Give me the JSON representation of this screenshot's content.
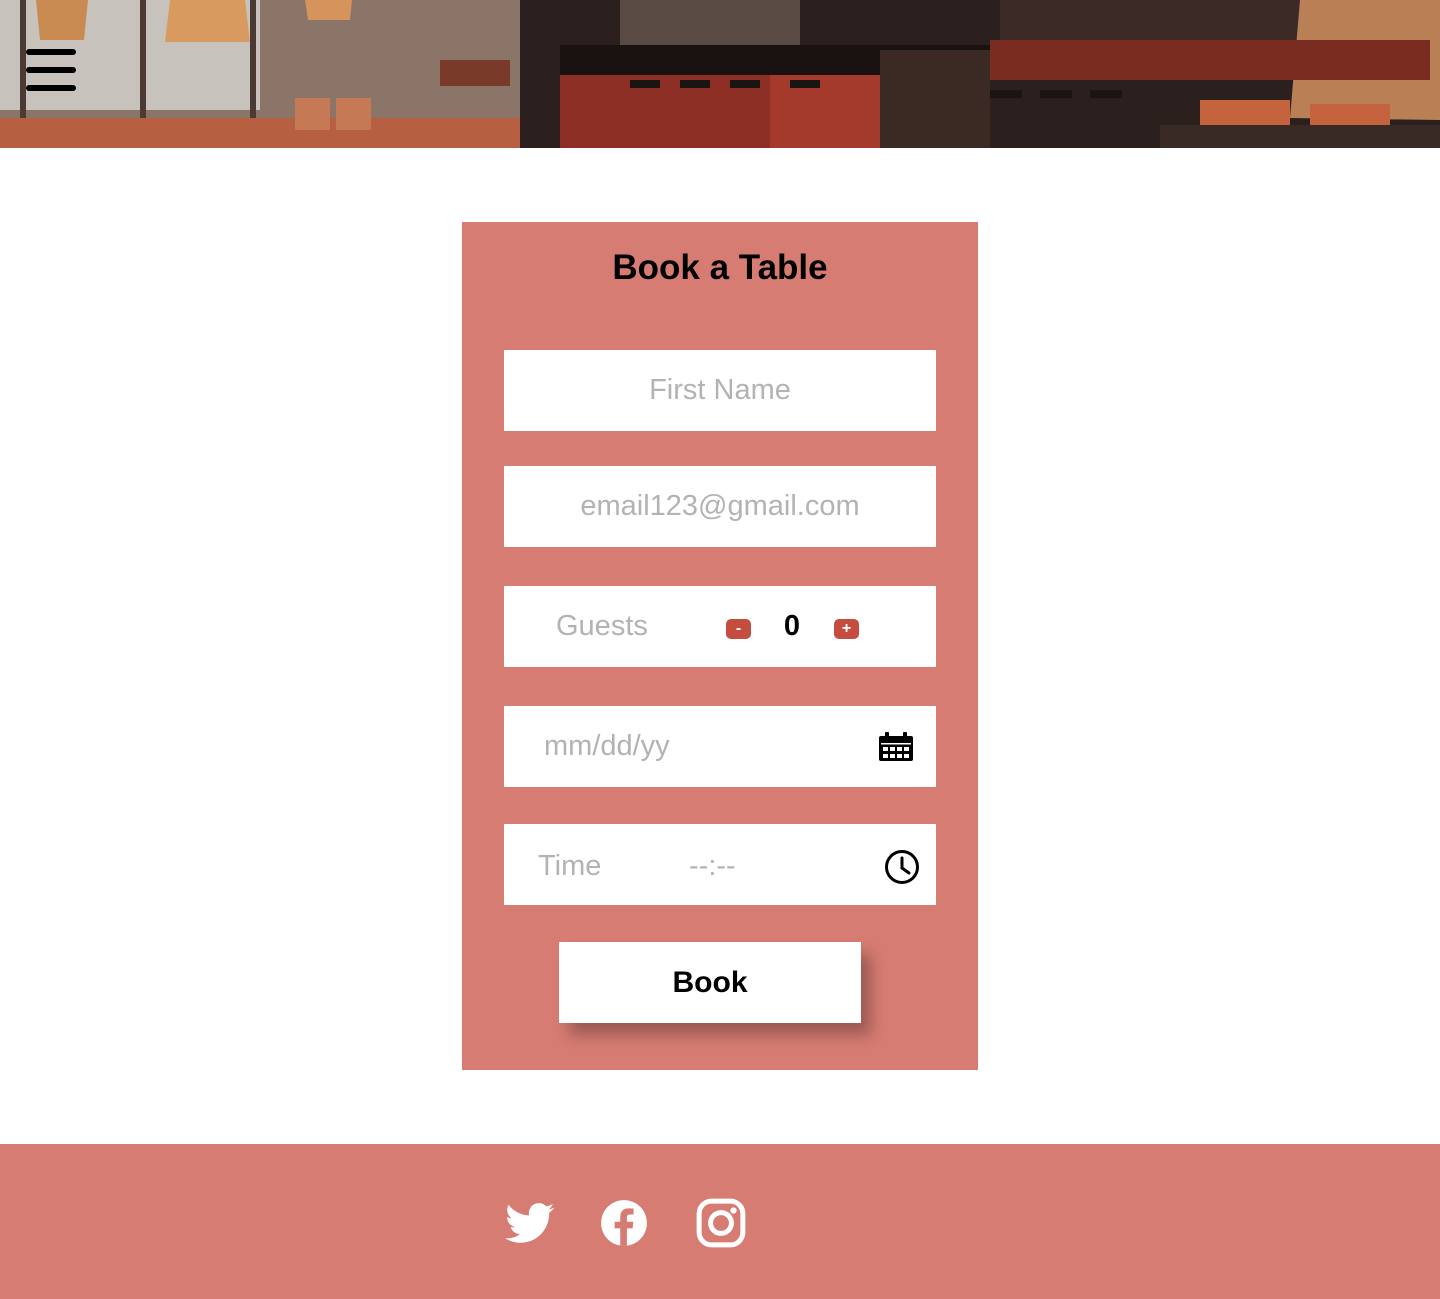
{
  "header": {
    "menu_icon": "hamburger-menu-icon",
    "banner_image": "restaurant-interior-photo"
  },
  "booking": {
    "title": "Book a Table",
    "first_name_placeholder": "First Name",
    "email_placeholder": "email123@gmail.com",
    "guests_label": "Guests",
    "guests_count": "0",
    "decrement_label": "-",
    "increment_label": "+",
    "date_placeholder": "mm/dd/yy",
    "date_icon": "calendar-icon",
    "time_label": "Time",
    "time_value": "--:--",
    "time_icon": "clock-icon",
    "submit_label": "Book"
  },
  "footer": {
    "social_links": [
      {
        "name": "Twitter",
        "icon": "twitter-icon"
      },
      {
        "name": "Facebook",
        "icon": "facebook-icon"
      },
      {
        "name": "Instagram",
        "icon": "instagram-icon"
      }
    ]
  },
  "colors": {
    "accent": "#d77c72",
    "stepper": "#c54d3f",
    "placeholder": "#b3b3b3"
  }
}
